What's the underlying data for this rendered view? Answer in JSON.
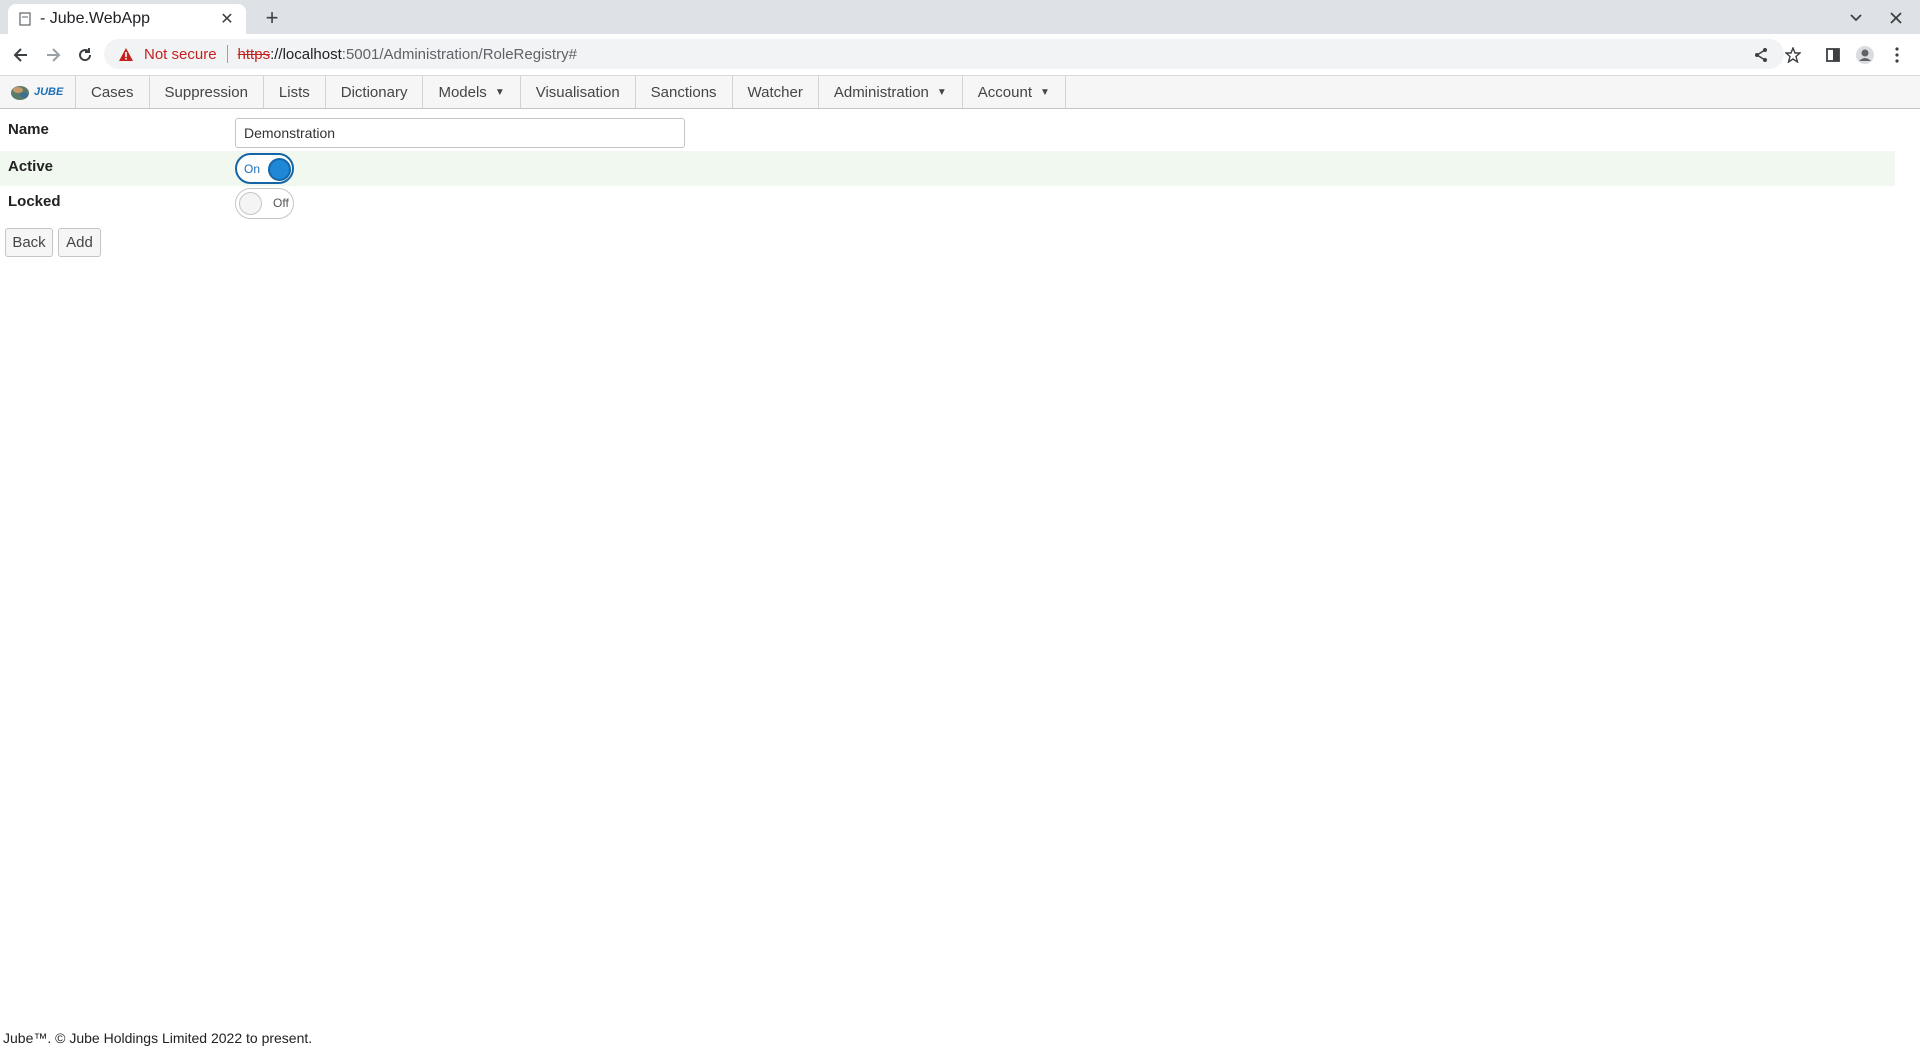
{
  "browser": {
    "tab_title": "- Jube.WebApp",
    "new_tab_symbol": "+",
    "tab_close_symbol": "✕",
    "security_label": "Not secure",
    "url_scheme": "https",
    "url_host": "://localhost",
    "url_path": ":5001/Administration/RoleRegistry#"
  },
  "app": {
    "logo_text": "JUBE",
    "nav": [
      {
        "label": "Cases"
      },
      {
        "label": "Suppression"
      },
      {
        "label": "Lists"
      },
      {
        "label": "Dictionary"
      },
      {
        "label": "Models",
        "dropdown": true
      },
      {
        "label": "Visualisation"
      },
      {
        "label": "Sanctions"
      },
      {
        "label": "Watcher"
      },
      {
        "label": "Administration",
        "dropdown": true
      },
      {
        "label": "Account",
        "dropdown": true
      }
    ]
  },
  "form": {
    "name_label": "Name",
    "name_value": "Demonstration",
    "active_label": "Active",
    "active_state": "On",
    "locked_label": "Locked",
    "locked_state": "Off",
    "back_label": "Back",
    "add_label": "Add"
  },
  "footer": {
    "text": "Jube™. © Jube Holdings Limited 2022 to present."
  },
  "colors": {
    "accent": "#1e88d6",
    "highlight_row": "#f0f8ef",
    "insecure": "#c5221f"
  }
}
